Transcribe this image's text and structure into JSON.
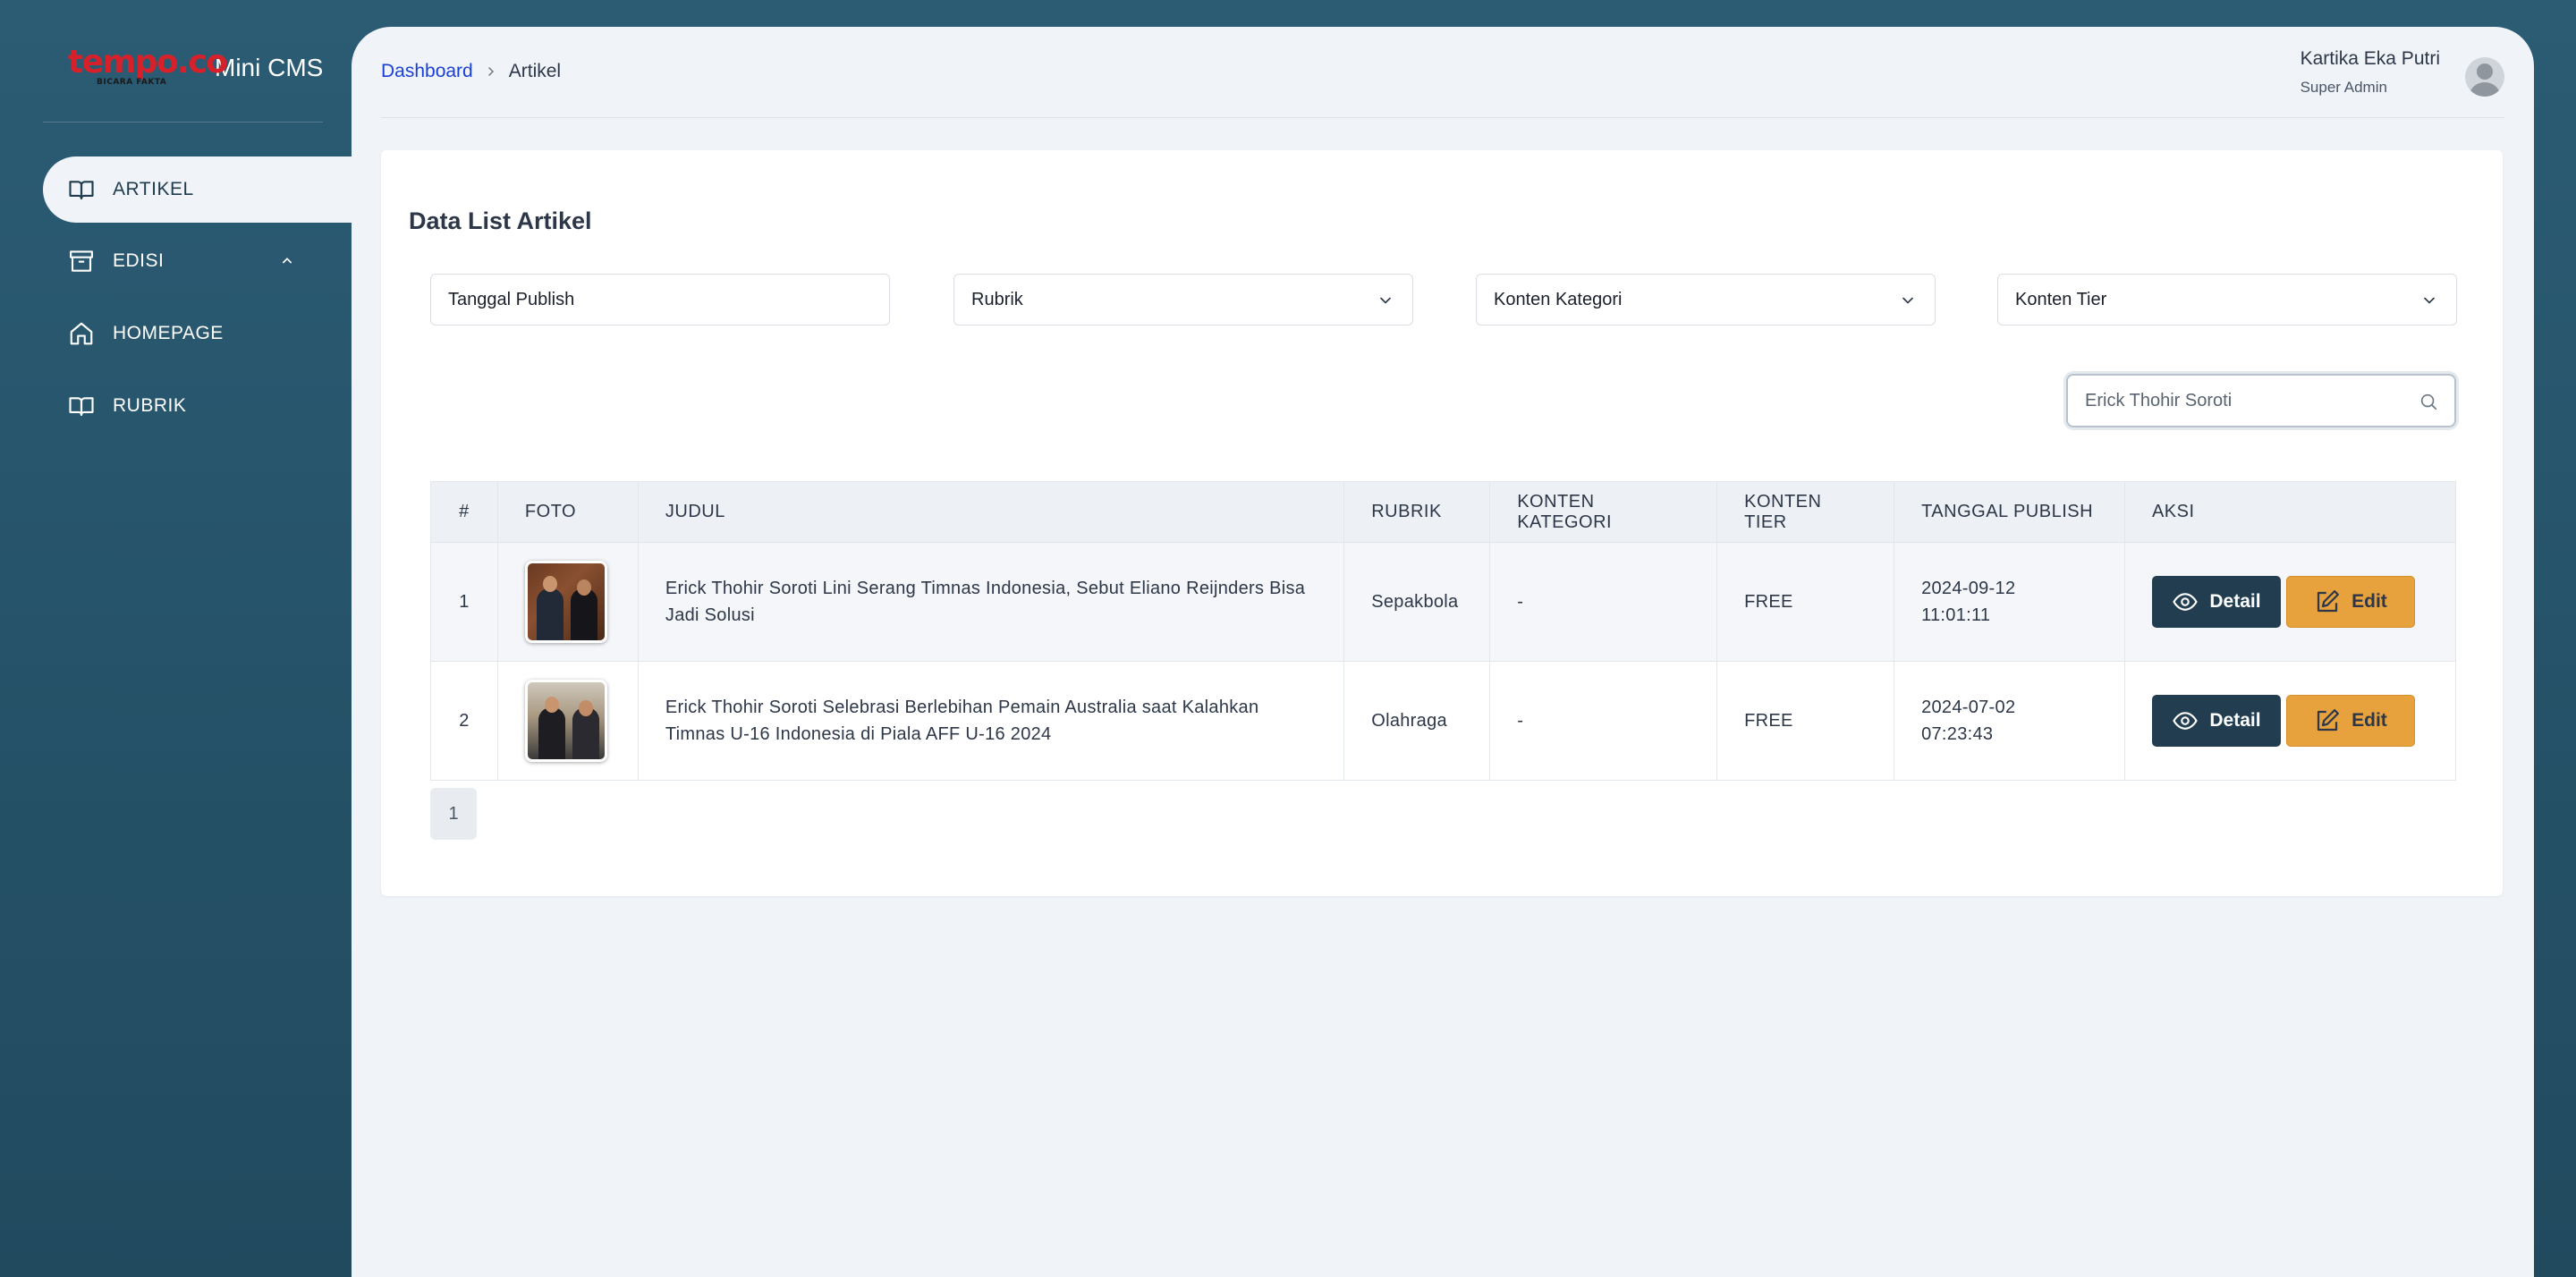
{
  "brand": {
    "logo_text": "tempo.co",
    "logo_tagline": "BICARA FAKTA",
    "app_name": "Mini CMS"
  },
  "sidebar": {
    "items": [
      {
        "label": "ARTIKEL",
        "icon": "book-open-icon",
        "active": true
      },
      {
        "label": "EDISI",
        "icon": "archive-box-icon",
        "expandable": true
      },
      {
        "label": "HOMEPAGE",
        "icon": "home-icon"
      },
      {
        "label": "RUBRIK",
        "icon": "book-open-icon"
      }
    ]
  },
  "breadcrumb": {
    "home": "Dashboard",
    "current": "Artikel"
  },
  "user": {
    "name": "Kartika Eka Putri",
    "role": "Super Admin"
  },
  "card": {
    "title": "Data List Artikel"
  },
  "filters": {
    "tanggal_publish": "Tanggal Publish",
    "rubrik": "Rubrik",
    "konten_kategori": "Konten Kategori",
    "konten_tier": "Konten Tier"
  },
  "search": {
    "value": "Erick Thohir Soroti"
  },
  "table": {
    "headers": [
      "#",
      "FOTO",
      "JUDUL",
      "RUBRIK",
      "KONTEN KATEGORI",
      "KONTEN TIER",
      "TANGGAL PUBLISH",
      "AKSI"
    ],
    "rows": [
      {
        "no": "1",
        "judul": "Erick Thohir Soroti Lini Serang Timnas Indonesia, Sebut Eliano Reijnders Bisa Jadi Solusi",
        "rubrik": "Sepakbola",
        "kategori": "-",
        "tier": "FREE",
        "tanggal": "2024-09-12",
        "jam": "11:01:11"
      },
      {
        "no": "2",
        "judul": "Erick Thohir Soroti Selebrasi Berlebihan Pemain Australia saat Kalahkan Timnas U-16 Indonesia di Piala AFF U-16 2024",
        "rubrik": "Olahraga",
        "kategori": "-",
        "tier": "FREE",
        "tanggal": "2024-07-02",
        "jam": "07:23:43"
      }
    ],
    "detail_label": "Detail",
    "edit_label": "Edit"
  },
  "pagination": {
    "current": "1"
  },
  "colors": {
    "background": "#2b5c74",
    "panel": "#f0f4f8",
    "detail_button": "#213d4f",
    "edit_button": "#e8a23d",
    "link": "#1a3fd6",
    "logo_red": "#d6202a"
  }
}
